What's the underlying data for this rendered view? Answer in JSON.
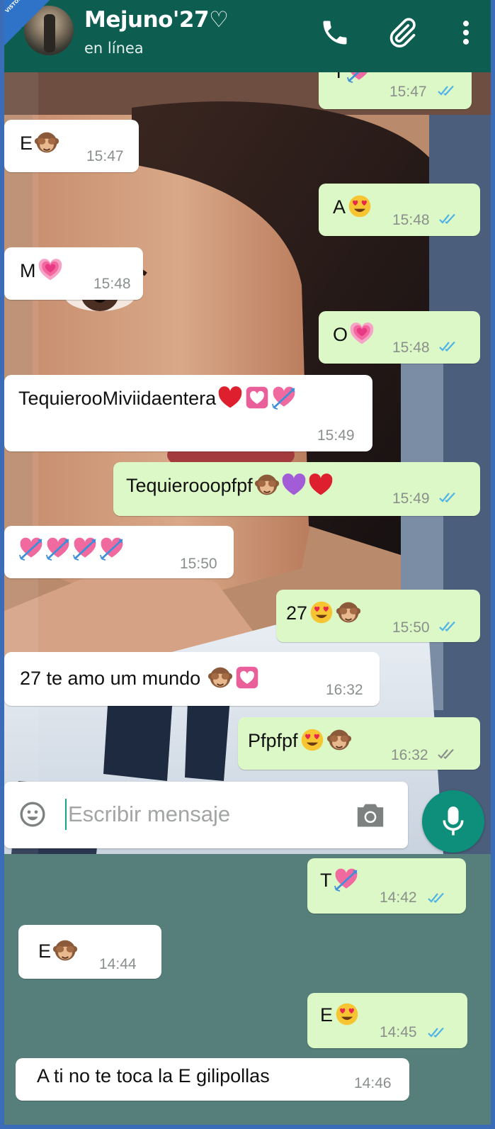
{
  "watermark": "VISTOENLASREDES",
  "header": {
    "contact_name": "Mejuno'27♡",
    "status": "en línea"
  },
  "upper_messages": [
    {
      "dir": "out",
      "text": "T",
      "emoji": [
        "heart-arrow"
      ],
      "time": "15:47",
      "ticks": "read"
    },
    {
      "dir": "in",
      "text": "E",
      "emoji": [
        "see-no-evil-monkey"
      ],
      "time": "15:47"
    },
    {
      "dir": "out",
      "text": "A",
      "emoji": [
        "heart-eyes"
      ],
      "time": "15:48",
      "ticks": "read"
    },
    {
      "dir": "in",
      "text": "M",
      "emoji": [
        "growing-heart"
      ],
      "time": "15:48"
    },
    {
      "dir": "out",
      "text": "O",
      "emoji": [
        "growing-heart"
      ],
      "time": "15:48",
      "ticks": "read"
    },
    {
      "dir": "in",
      "text": "TequierooMiviidaentera",
      "emoji": [
        "red-heart",
        "heart-box",
        "heart-arrow"
      ],
      "time": "15:49"
    },
    {
      "dir": "out",
      "text": "Tequierooopfpf",
      "emoji": [
        "see-no-evil-monkey",
        "purple-heart",
        "red-heart"
      ],
      "time": "15:49",
      "ticks": "read"
    },
    {
      "dir": "in",
      "text": "",
      "emoji": [
        "heart-arrow",
        "heart-arrow",
        "heart-arrow",
        "heart-arrow"
      ],
      "time": "15:50"
    },
    {
      "dir": "out",
      "text": "27",
      "emoji": [
        "heart-eyes",
        "see-no-evil-monkey"
      ],
      "time": "15:50",
      "ticks": "read"
    },
    {
      "dir": "in",
      "text": "27 te amo um mundo ",
      "emoji": [
        "see-no-evil-monkey",
        "heart-box"
      ],
      "time": "16:32"
    },
    {
      "dir": "out",
      "text": "Pfpfpf",
      "emoji": [
        "heart-eyes",
        "see-no-evil-monkey"
      ],
      "time": "16:32",
      "ticks": "delivered"
    }
  ],
  "input": {
    "placeholder": "Escribir mensaje"
  },
  "lower_messages": [
    {
      "dir": "out",
      "text": "T",
      "emoji": [
        "heart-arrow"
      ],
      "time": "14:42",
      "ticks": "read"
    },
    {
      "dir": "in",
      "text": "E",
      "emoji": [
        "see-no-evil-monkey"
      ],
      "time": "14:44"
    },
    {
      "dir": "out",
      "text": "E",
      "emoji": [
        "heart-eyes"
      ],
      "time": "14:45",
      "ticks": "read"
    },
    {
      "dir": "in",
      "text": "A ti no te toca la E gilipollas",
      "emoji": [],
      "time": "14:46"
    }
  ],
  "colors": {
    "header": "#0d5d50",
    "outgoing_bubble": "#dcf8c6",
    "incoming_bubble": "#ffffff",
    "read_tick": "#4fb3e8",
    "mic_button": "#0d8f7c"
  }
}
